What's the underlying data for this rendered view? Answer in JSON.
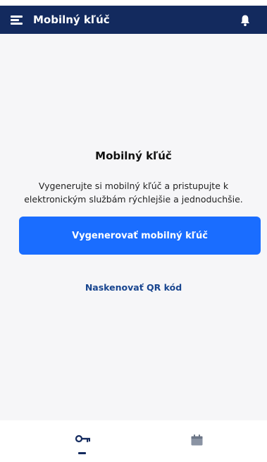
{
  "app_bar": {
    "title": "Mobilný kľúč",
    "menu_icon": "menu-icon",
    "notification_icon": "bell-icon"
  },
  "main": {
    "heading": "Mobilný kľúč",
    "description": "Vygenerujte si mobilný kľúč a pristupujte k elektronickým službám rýchlejšie a jednoduchšie.",
    "primary_button_label": "Vygenerovať mobilný kľúč",
    "secondary_link_label": "Naskenovať QR kód"
  },
  "bottom_nav": {
    "items": [
      {
        "icon": "key-icon",
        "active": true
      },
      {
        "icon": "calendar-icon",
        "active": false
      }
    ]
  },
  "colors": {
    "app_bar": "#132a5e",
    "primary": "#1a6dff",
    "link": "#18458f",
    "background": "#f6f6f8"
  }
}
